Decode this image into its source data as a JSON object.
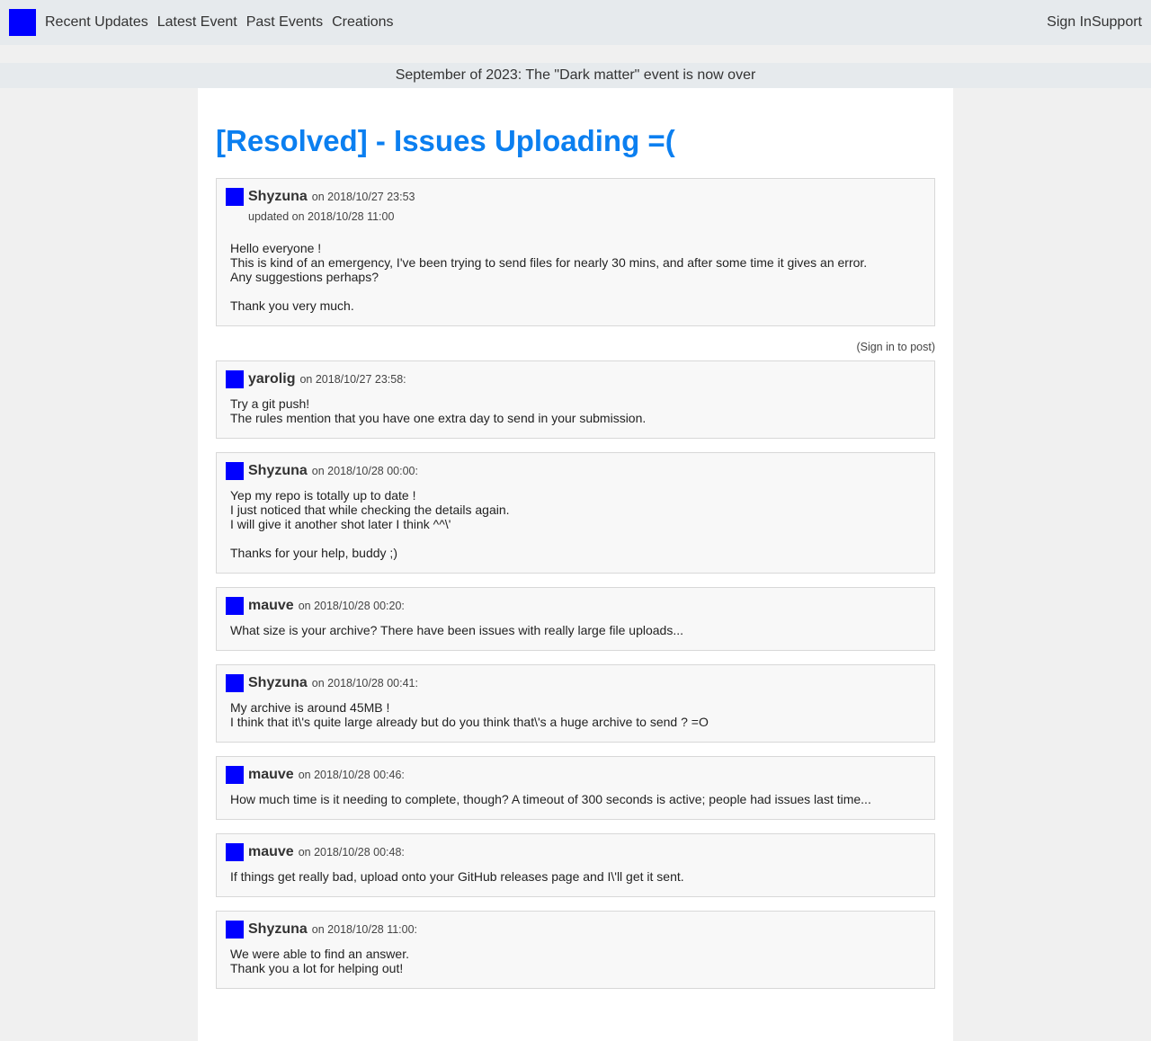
{
  "nav": {
    "links": [
      "Recent Updates",
      "Latest Event",
      "Past Events",
      "Creations"
    ],
    "sign_in": "Sign In",
    "support": "Support"
  },
  "banner": "September of 2023: The \"Dark matter\" event is now over",
  "thread": {
    "title": "[Resolved] - Issues Uploading =(",
    "op": {
      "author": "Shyzuna",
      "date": "on 2018/10/27 23:53",
      "updated": "updated on 2018/10/28 11:00",
      "paragraphs": [
        [
          "Hello everyone !",
          "This is kind of an emergency, I've been trying to send files for nearly 30 mins, and after some time it gives an error.",
          "Any suggestions perhaps?"
        ],
        [
          "Thank you very much."
        ]
      ]
    },
    "sign_in_note": "(Sign in to post)",
    "replies": [
      {
        "author": "yarolig",
        "date": "on 2018/10/27 23:58:",
        "paragraphs": [
          [
            "Try a git push!",
            "The rules mention that you have one extra day to send in your submission."
          ]
        ]
      },
      {
        "author": "Shyzuna",
        "date": "on 2018/10/28 00:00:",
        "paragraphs": [
          [
            "Yep my repo is totally up to date !",
            "I just noticed that while checking the details again.",
            "I will give it another shot later I think ^^\\'"
          ],
          [
            "Thanks for your help, buddy ;)"
          ]
        ]
      },
      {
        "author": "mauve",
        "date": "on 2018/10/28 00:20:",
        "paragraphs": [
          [
            "What size is your archive? There have been issues with really large file uploads..."
          ]
        ]
      },
      {
        "author": "Shyzuna",
        "date": "on 2018/10/28 00:41:",
        "paragraphs": [
          [
            "My archive is around 45MB !",
            "I think that it\\'s quite large already but do you think that\\'s a huge archive to send ? =O"
          ]
        ]
      },
      {
        "author": "mauve",
        "date": "on 2018/10/28 00:46:",
        "paragraphs": [
          [
            "How much time is it needing to complete, though? A timeout of 300 seconds is active; people had issues last time..."
          ]
        ]
      },
      {
        "author": "mauve",
        "date": "on 2018/10/28 00:48:",
        "paragraphs": [
          [
            "If things get really bad, upload onto your GitHub releases page and I\\'ll get it sent."
          ]
        ]
      },
      {
        "author": "Shyzuna",
        "date": "on 2018/10/28 11:00:",
        "paragraphs": [
          [
            "We were able to find an answer.",
            "Thank you a lot for helping out!"
          ]
        ]
      }
    ]
  },
  "colors": {
    "accent": "#0b7ff0",
    "avatar": "#0000ff",
    "nav_bg": "#e6eaed",
    "page_bg": "#f0f0f0"
  }
}
